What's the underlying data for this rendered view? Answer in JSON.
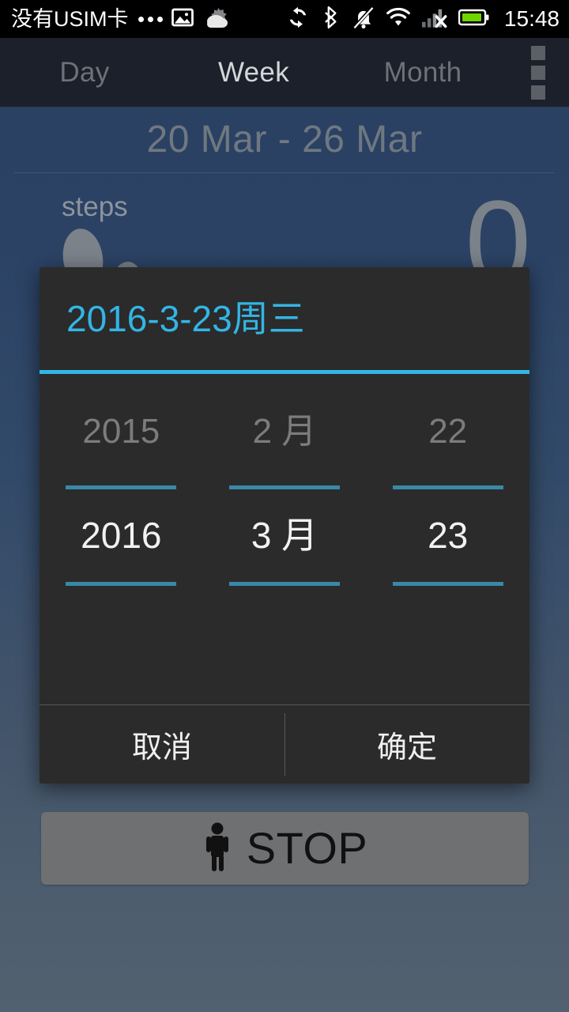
{
  "status_bar": {
    "carrier": "没有USIM卡",
    "clock": "15:48",
    "icons": [
      "more-dots-icon",
      "image-icon",
      "weather-cloud-icon",
      "sync-icon",
      "bluetooth-icon",
      "silent-bell-icon",
      "wifi-icon",
      "signal-no-service-icon",
      "battery-icon"
    ]
  },
  "tabs": {
    "items": [
      {
        "label": "Day",
        "selected": false
      },
      {
        "label": "Week",
        "selected": true
      },
      {
        "label": "Month",
        "selected": false
      }
    ],
    "overflow_label": "overflow-menu"
  },
  "header": {
    "date_range": "20 Mar - 26 Mar"
  },
  "steps_card": {
    "label": "steps",
    "value": "0"
  },
  "stop_button": {
    "label": "STOP",
    "icon": "walking-person-icon"
  },
  "dialog": {
    "title": "2016-3-23周三",
    "wheels": [
      {
        "name": "year",
        "previous": "2015",
        "current": "2016"
      },
      {
        "name": "month",
        "previous": "2 月",
        "current": "3 月"
      },
      {
        "name": "day",
        "previous": "22",
        "current": "23"
      }
    ],
    "cancel_label": "取消",
    "confirm_label": "确定"
  },
  "colors": {
    "accent_cyan": "#33b5e5",
    "wheel_line": "#3a88a8",
    "dialog_bg": "#2b2b2b",
    "tab_selected_bg": "#25395a",
    "battery_green": "#6fd500"
  }
}
